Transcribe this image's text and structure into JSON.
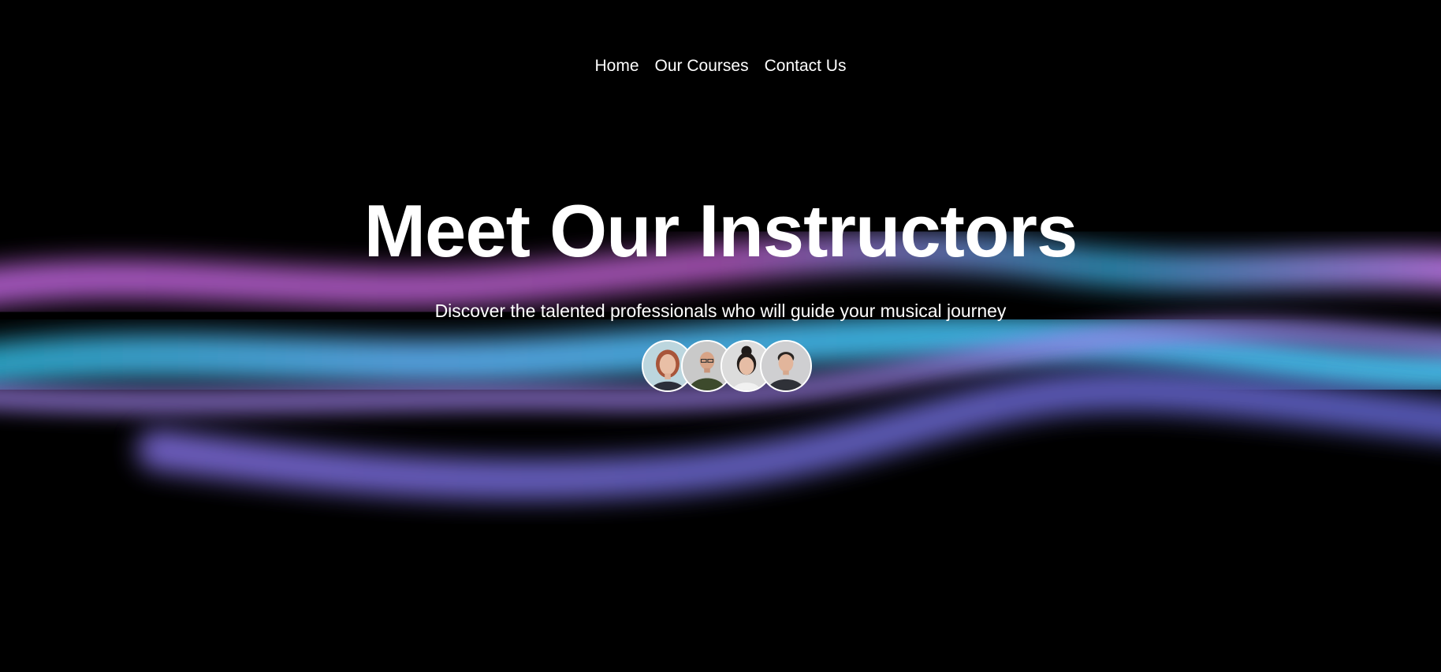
{
  "nav": {
    "items": [
      {
        "label": "Home"
      },
      {
        "label": "Our Courses"
      },
      {
        "label": "Contact Us"
      }
    ]
  },
  "hero": {
    "title": "Meet Our Instructors",
    "subtitle": "Discover the talented professionals who will guide your musical journey"
  },
  "instructors": [
    {
      "icon": "avatar-woman-red-hair"
    },
    {
      "icon": "avatar-bald-man-glasses"
    },
    {
      "icon": "avatar-woman-hair-bun"
    },
    {
      "icon": "avatar-young-man"
    }
  ],
  "colors": {
    "background": "#000000",
    "text": "#ffffff",
    "wave_pink": "#c86ee6",
    "wave_cyan": "#3fb8e6",
    "wave_indigo": "#6a6ad8"
  }
}
